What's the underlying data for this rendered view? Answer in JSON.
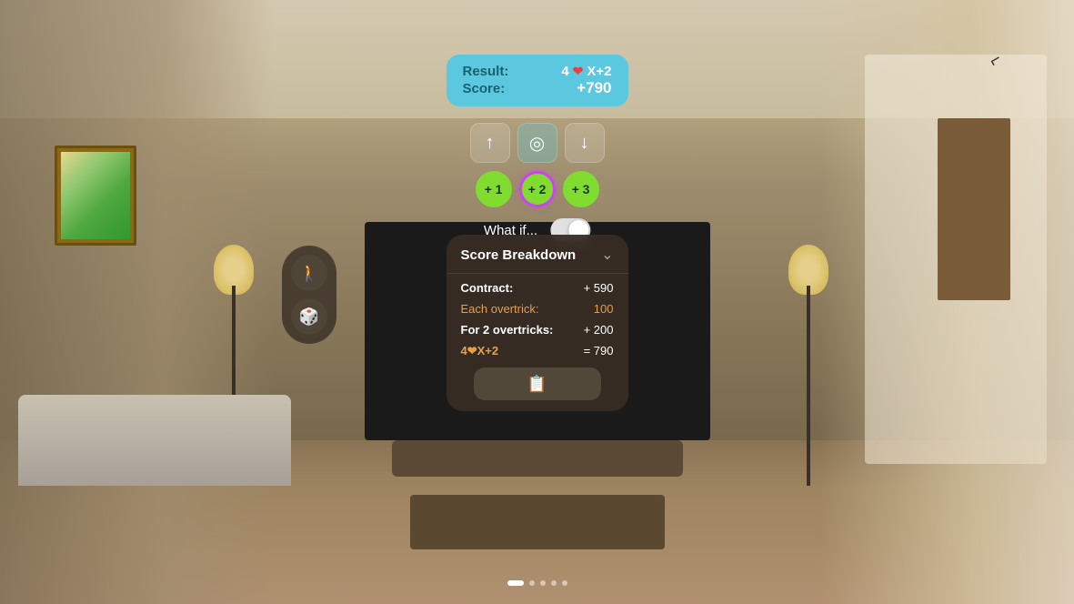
{
  "background": {
    "type": "room"
  },
  "result_box": {
    "result_label": "Result:",
    "result_value": "4 ❤ X+2",
    "score_label": "Score:",
    "score_value": "+790"
  },
  "nav_buttons": [
    {
      "id": "up",
      "icon": "↑",
      "label": "up-arrow"
    },
    {
      "id": "target",
      "icon": "◎",
      "label": "target"
    },
    {
      "id": "down",
      "icon": "↓",
      "label": "down-arrow"
    }
  ],
  "trick_buttons": [
    {
      "label": "+ 1",
      "active": false
    },
    {
      "label": "+ 2",
      "active": true
    },
    {
      "label": "+ 3",
      "active": false
    }
  ],
  "whatif": {
    "label": "What if...",
    "toggle_state": "off"
  },
  "breakdown": {
    "title": "Score Breakdown",
    "rows": [
      {
        "label": "Contract:",
        "value": "+ 590",
        "style": "normal"
      },
      {
        "label": "Each overtrick:",
        "value": "100",
        "style": "orange"
      },
      {
        "label": "For 2 overtricks:",
        "value": "+ 200",
        "style": "normal"
      },
      {
        "label": "4❤X+2",
        "value": "= 790",
        "style": "summary"
      }
    ],
    "copy_icon": "📋"
  },
  "side_panel": {
    "buttons": [
      {
        "icon": "🚶",
        "label": "person-icon"
      },
      {
        "icon": "🎲",
        "label": "dice-icon"
      }
    ]
  },
  "page_indicator": {
    "dots": [
      {
        "active": true
      },
      {
        "active": false
      },
      {
        "active": false
      },
      {
        "active": false
      },
      {
        "active": false
      }
    ]
  }
}
